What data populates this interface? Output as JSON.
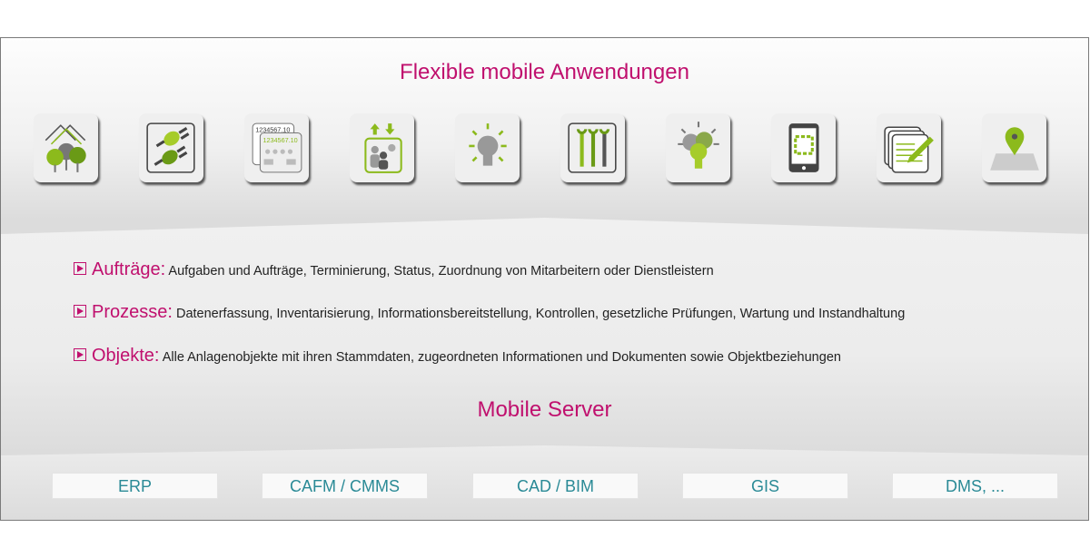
{
  "header": {
    "title": "Flexible mobile Anwendungen"
  },
  "icons": [
    "houses-trees-icon",
    "plug-connect-icon",
    "meter-reading-icon",
    "people-exchange-icon",
    "lightbulb-icon",
    "wrenches-icon",
    "multiple-lightbulbs-icon",
    "smartphone-qr-icon",
    "documents-pencil-icon",
    "map-pin-icon"
  ],
  "meter_text": {
    "back": "1234567.10",
    "front": "1234567.10"
  },
  "features": [
    {
      "key": "Aufträge:",
      "text": "Aufgaben und Aufträge, Terminierung, Status, Zuordnung von Mitarbeitern oder Dienstleistern"
    },
    {
      "key": "Prozesse:",
      "text": "Datenerfassung, Inventarisierung, Informationsbereitstellung, Kontrollen, gesetzliche Prüfungen, Wartung und Instandhaltung"
    },
    {
      "key": "Objekte:",
      "text": "Alle Anlagenobjekte mit ihren Stammdaten, zugeordneten Informationen und Dokumenten sowie Objektbeziehungen"
    }
  ],
  "server": {
    "title": "Mobile Server"
  },
  "systems": [
    "ERP",
    "CAFM / CMMS",
    "CAD / BIM",
    "GIS",
    "DMS, ..."
  ],
  "colors": {
    "accent": "#c0106e",
    "green": "#8cba1c",
    "teal": "#2a8a96",
    "gray": "#7a7a7a"
  }
}
